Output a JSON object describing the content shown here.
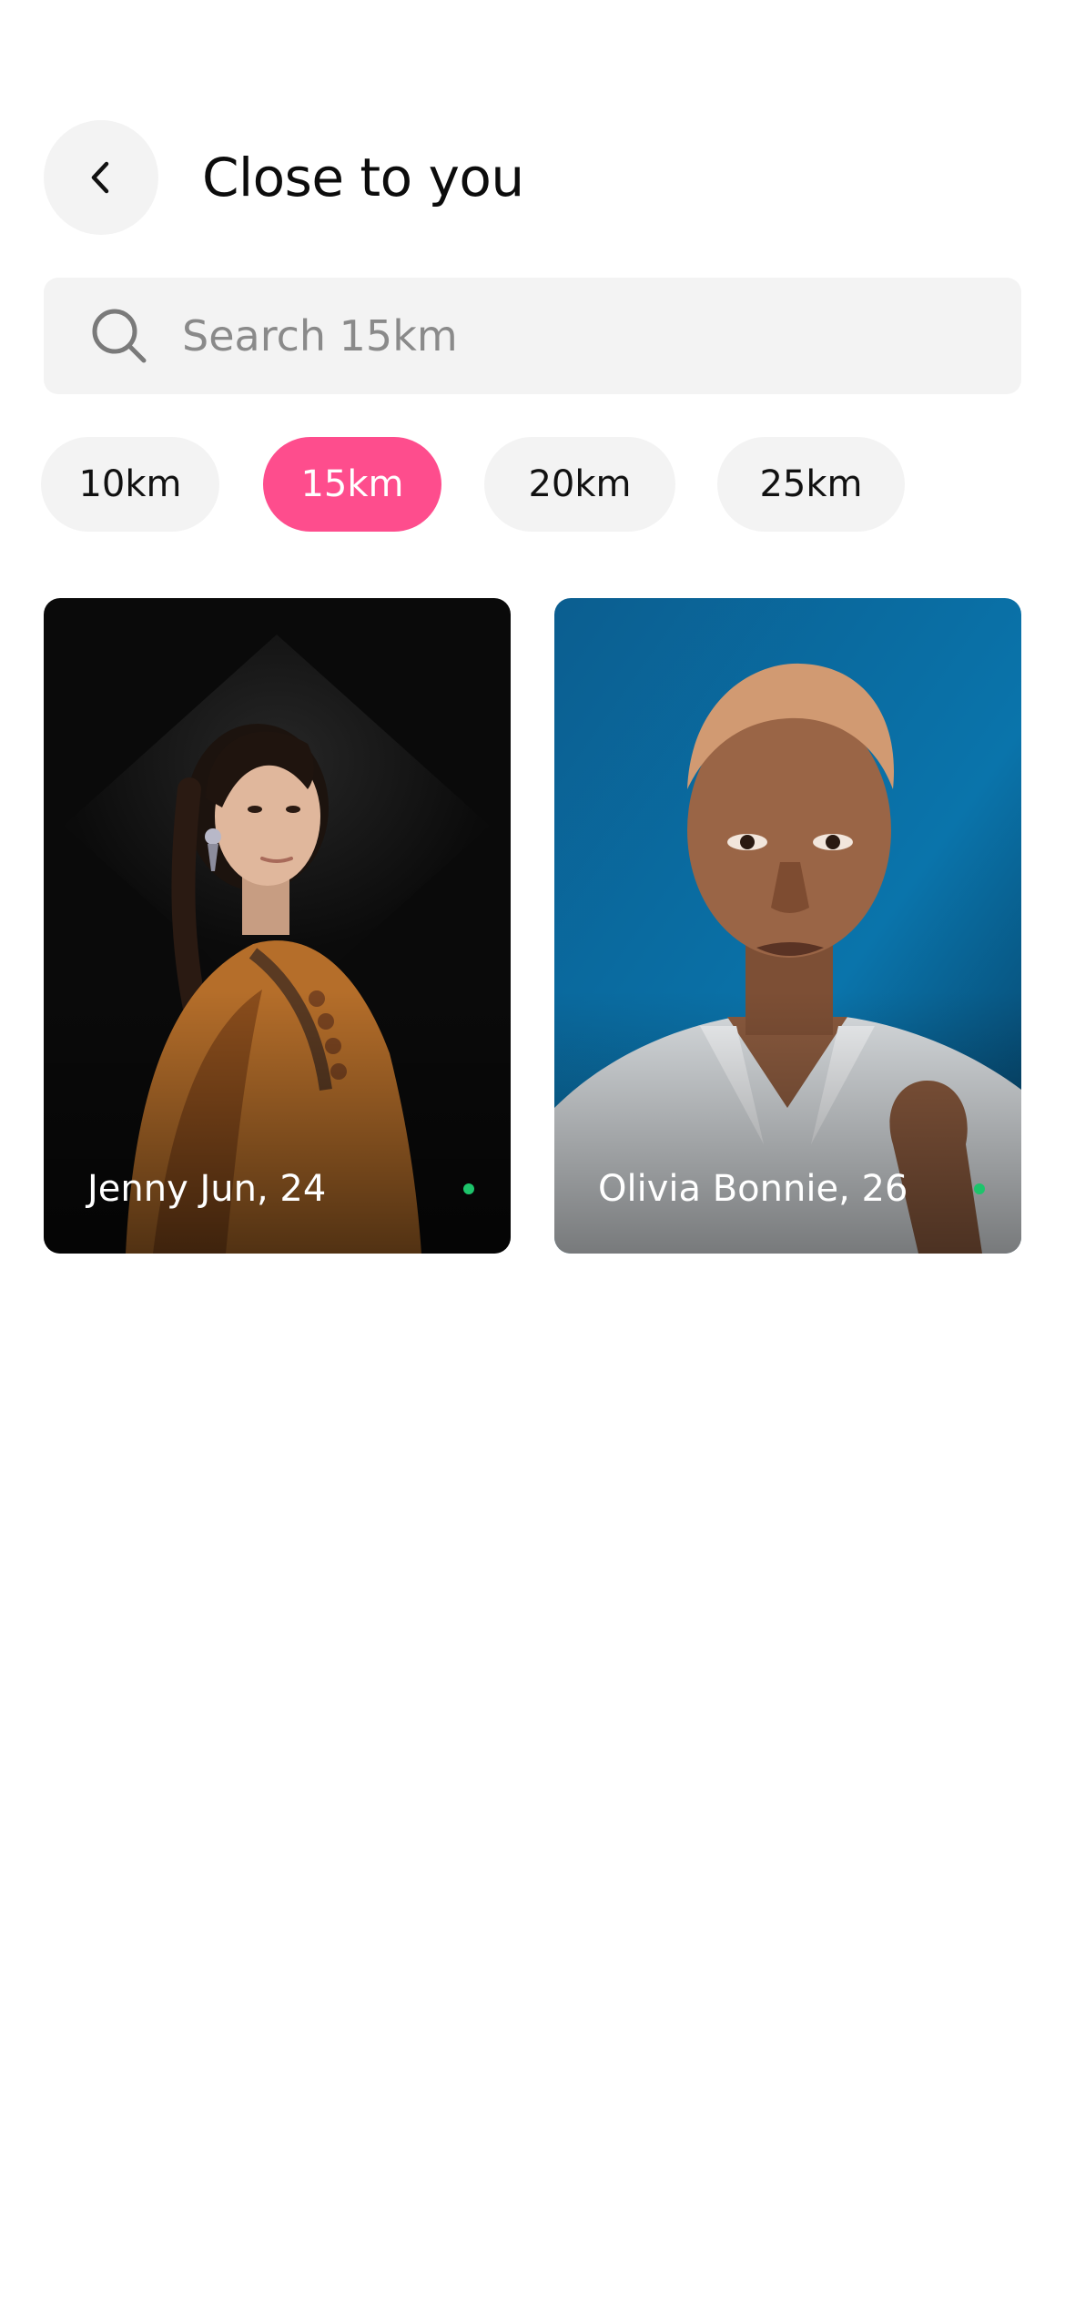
{
  "header": {
    "title": "Close to you",
    "back_icon": "chevron-left-icon"
  },
  "search": {
    "placeholder": "Search 15km",
    "value": "",
    "icon": "search-icon"
  },
  "filters": {
    "options": [
      {
        "label": "10km",
        "selected": false
      },
      {
        "label": "15km",
        "selected": true
      },
      {
        "label": "20km",
        "selected": false
      },
      {
        "label": "25km",
        "selected": false
      }
    ],
    "selected_color": "#fe4d8d"
  },
  "profiles": [
    {
      "name": "Jenny Jun, 24",
      "online": true
    },
    {
      "name": "Olivia Bonnie, 26",
      "online": true
    }
  ],
  "colors": {
    "accent": "#fe4d8d",
    "online": "#1dc46b",
    "chip_background": "#f3f3f3"
  }
}
